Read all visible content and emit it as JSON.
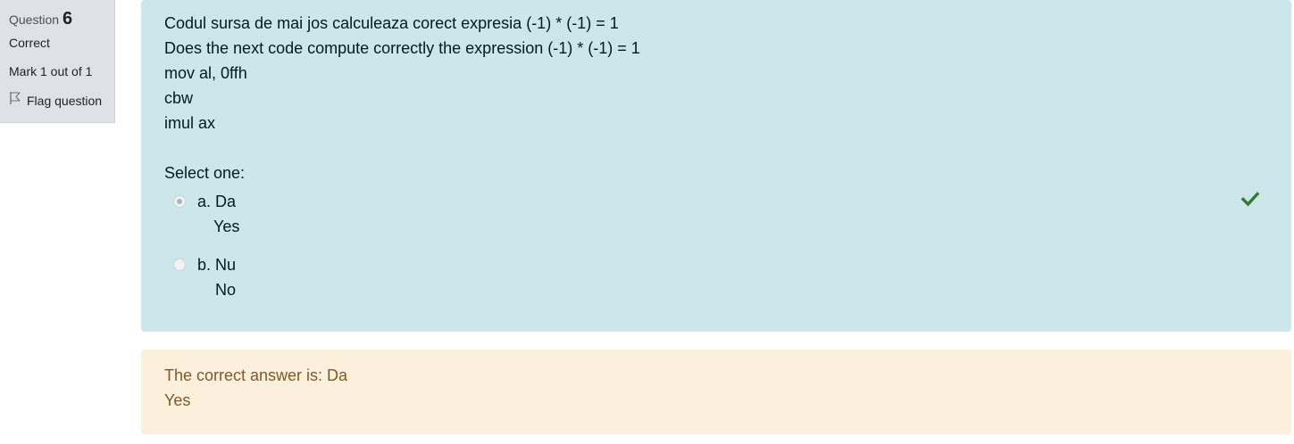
{
  "info": {
    "question_label": "Question",
    "question_number": "6",
    "state": "Correct",
    "grade": "Mark 1 out of 1",
    "flag_label": "Flag question",
    "flag_icon": "flag-outline-icon"
  },
  "question": {
    "text_lines": [
      "Codul sursa de mai jos calculeaza corect expresia (-1) * (-1) = 1",
      "Does the next code compute correctly the expression (-1) * (-1) = 1",
      "mov al, 0ffh",
      "cbw",
      "imul ax"
    ],
    "prompt": "Select one:",
    "options": [
      {
        "label": "a. Da",
        "sublabel": "Yes",
        "selected": true
      },
      {
        "label": "b. Nu",
        "sublabel": "No",
        "selected": false
      }
    ],
    "status_icon": "checkmark-icon",
    "status_color": "#357a32"
  },
  "feedback": {
    "line1": "The correct answer is: Da",
    "line2": "Yes"
  },
  "colors": {
    "question_bg": "#cce6ea",
    "feedback_bg": "#fcefdc",
    "info_bg": "#dee2e6"
  }
}
